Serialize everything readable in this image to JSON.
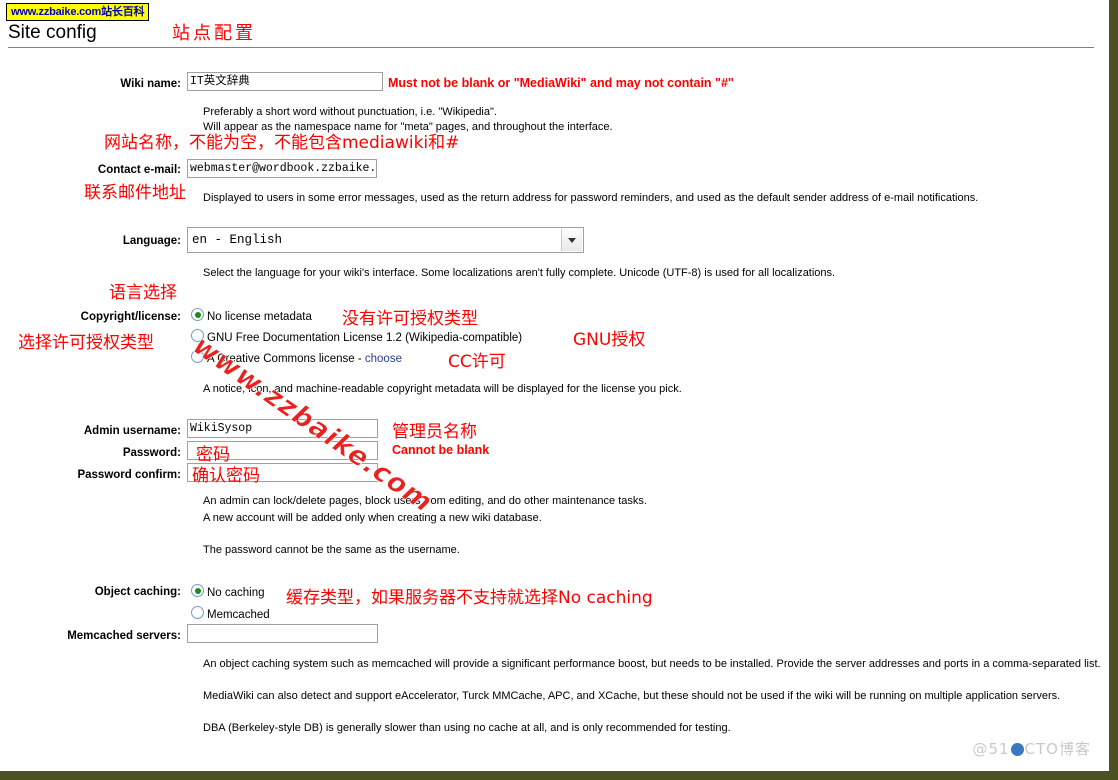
{
  "banner": {
    "text": "www.zzbaike.com站长百科"
  },
  "header": {
    "title": "Site config",
    "title_cn": "站点配置"
  },
  "form": {
    "wiki_name": {
      "label": "Wiki name:",
      "value": "IT英文辞典",
      "error": "Must not be blank or \"MediaWiki\" and may not contain \"#\"",
      "help1": "Preferably a short word without punctuation, i.e. \"Wikipedia\".",
      "help2": "Will appear as the namespace name for \"meta\" pages, and throughout the interface.",
      "annotation": "网站名称，不能为空，不能包含mediawiki和#"
    },
    "contact_email": {
      "label": "Contact e-mail:",
      "value": "webmaster@wordbook.zzbaike.",
      "help": "Displayed to users in some error messages, used as the return address for password reminders, and used as the default sender address of e-mail notifications.",
      "annotation": "联系邮件地址"
    },
    "language": {
      "label": "Language:",
      "value": "en - English",
      "help": "Select the language for your wiki's interface. Some localizations aren't fully complete. Unicode (UTF-8) is used for all localizations.",
      "annotation": "语言选择"
    },
    "copyright": {
      "label": "Copyright/license:",
      "annotation": "选择许可授权类型",
      "options": [
        {
          "label": "No license metadata",
          "selected": true,
          "annotation": "没有许可授权类型"
        },
        {
          "label": "GNU Free Documentation License 1.2 (Wikipedia-compatible)",
          "selected": false,
          "annotation": "GNU授权"
        },
        {
          "label": "A Creative Commons license",
          "link": "choose",
          "selected": false,
          "annotation": "CC许可"
        }
      ],
      "help": "A notice, icon, and machine-readable copyright metadata will be displayed for the license you pick."
    },
    "admin_username": {
      "label": "Admin username:",
      "value": "WikiSysop",
      "annotation": "管理员名称"
    },
    "password": {
      "label": "Password:",
      "value": "",
      "error": "Cannot be blank",
      "annotation": "密码"
    },
    "password_confirm": {
      "label": "Password confirm:",
      "value": "",
      "annotation": "确认密码"
    },
    "admin_help": {
      "line1": "An admin can lock/delete pages, block users from editing, and do other maintenance tasks.",
      "line2": "A new account will be added only when creating a new wiki database.",
      "line3": "The password cannot be the same as the username."
    },
    "object_caching": {
      "label": "Object caching:",
      "annotation": "缓存类型，如果服务器不支持就选择No caching",
      "options": [
        {
          "label": "No caching",
          "selected": true
        },
        {
          "label": "Memcached",
          "selected": false
        }
      ]
    },
    "memcached_servers": {
      "label": "Memcached servers:",
      "value": ""
    },
    "caching_help": {
      "line1": "An object caching system such as memcached will provide a significant performance boost, but needs to be installed. Provide the server addresses and ports in a comma-separated list.",
      "line2": "MediaWiki can also detect and support eAccelerator, Turck MMCache, APC, and XCache, but these should not be used if the wiki will be running on multiple application servers.",
      "line3": "DBA (Berkeley-style DB) is generally slower than using no cache at all, and is only recommended for testing."
    }
  },
  "watermarks": {
    "diagonal": "www.zzbaike.com",
    "corner_prefix": "@51",
    "corner_suffix": "CTO博客"
  },
  "colors": {
    "accent_red": "#ff0000",
    "banner_bg": "#ffff00",
    "banner_fg": "#0000bb",
    "border": "#4e5222"
  }
}
